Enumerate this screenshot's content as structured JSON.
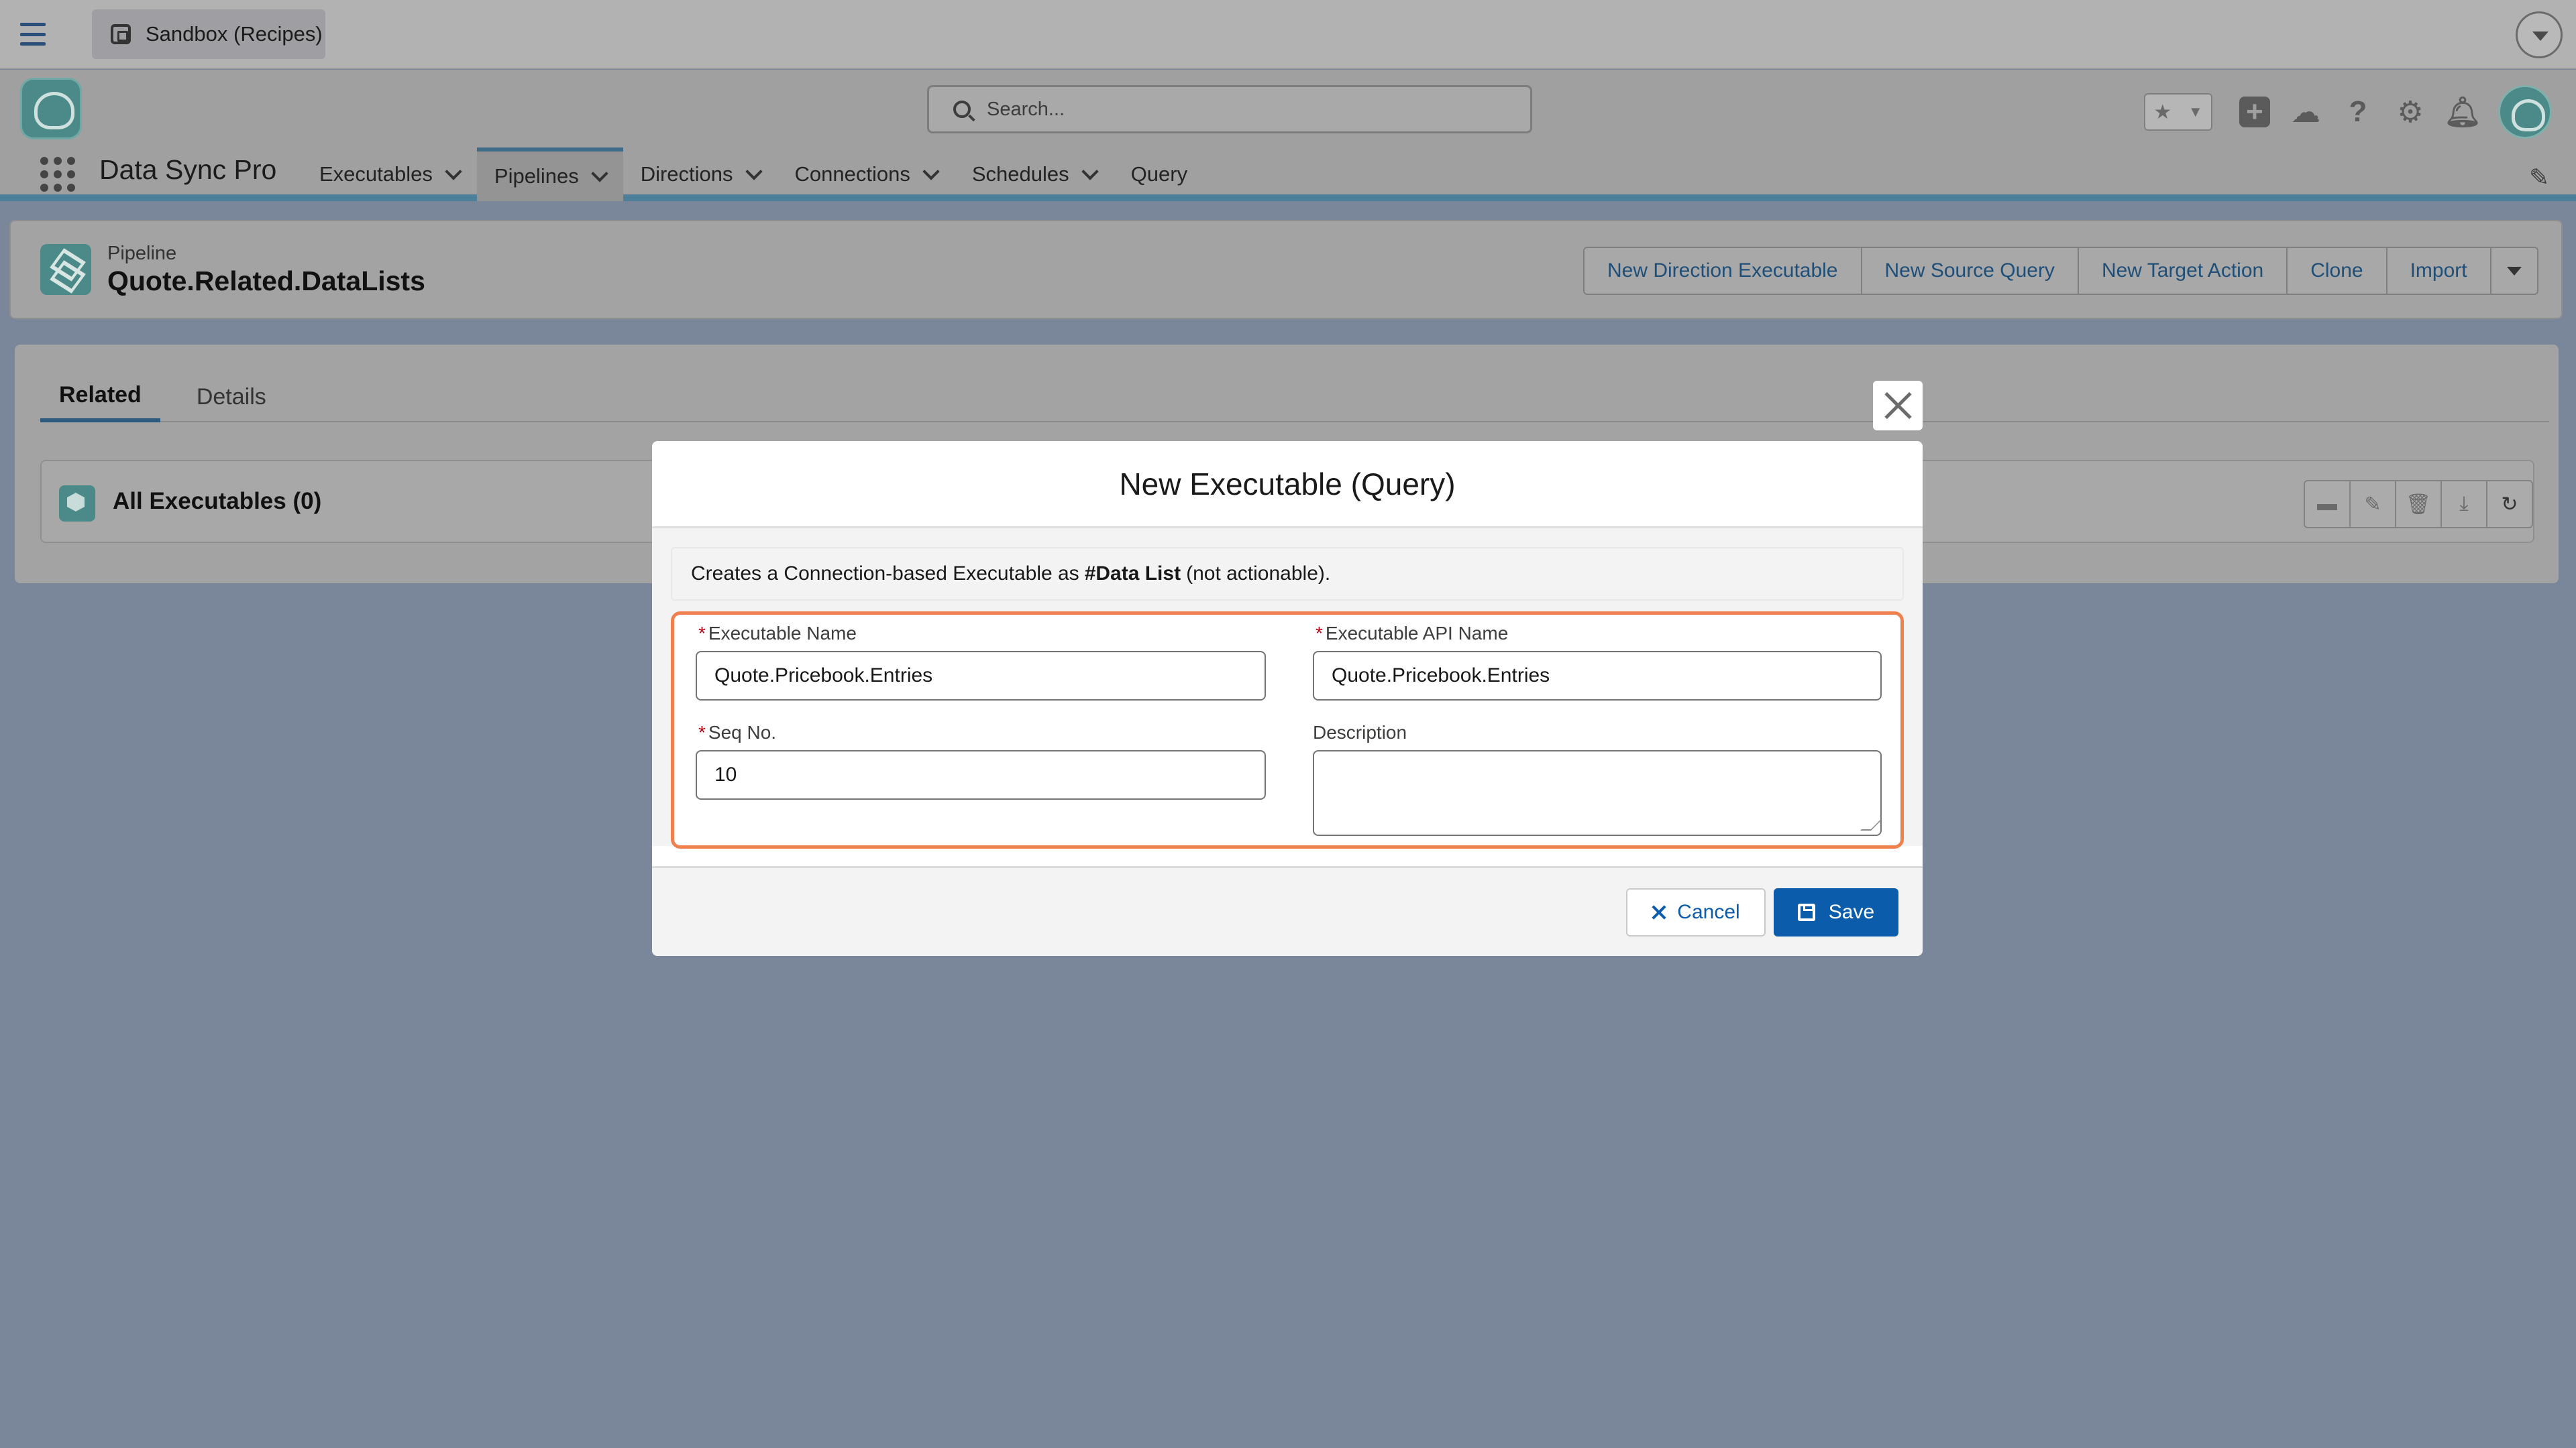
{
  "topbar": {
    "sandbox_label": "Sandbox (Recipes)"
  },
  "header": {
    "search_placeholder": "Search...",
    "app_name": "Data Sync Pro",
    "nav": [
      {
        "label": "Executables",
        "has_menu": true
      },
      {
        "label": "Pipelines",
        "has_menu": true,
        "active": true
      },
      {
        "label": "Directions",
        "has_menu": true
      },
      {
        "label": "Connections",
        "has_menu": true
      },
      {
        "label": "Schedules",
        "has_menu": true
      },
      {
        "label": "Query",
        "has_menu": false
      }
    ],
    "utility_icons": [
      "star-icon",
      "add-icon",
      "trailhead-icon",
      "help-icon",
      "setup-gear-icon",
      "bell-icon"
    ]
  },
  "record": {
    "object_type": "Pipeline",
    "title": "Quote.Related.DataLists",
    "actions": [
      "New Direction Executable",
      "New Source Query",
      "New Target Action",
      "Clone",
      "Import"
    ]
  },
  "tabs": [
    {
      "label": "Related",
      "active": true
    },
    {
      "label": "Details",
      "active": false
    }
  ],
  "related_list": {
    "title": "All Executables (0)",
    "action_icons": [
      "new-record-icon",
      "edit-icon",
      "delete-icon",
      "download-icon",
      "refresh-icon"
    ]
  },
  "modal": {
    "title": "New Executable (Query)",
    "info_prefix": "Creates a Connection-based Executable as",
    "info_bold": "#Data List",
    "info_suffix": "(not actionable).",
    "fields": {
      "executable_name": {
        "label": "Executable Name",
        "required": true,
        "value": "Quote.Pricebook.Entries"
      },
      "executable_api_name": {
        "label": "Executable API Name",
        "required": true,
        "value": "Quote.Pricebook.Entries"
      },
      "seq_no": {
        "label": "Seq No.",
        "required": true,
        "value": "10"
      },
      "description": {
        "label": "Description",
        "required": false,
        "value": ""
      }
    },
    "cancel_label": "Cancel",
    "save_label": "Save"
  },
  "colors": {
    "brand_blue": "#0b5cab",
    "highlight_orange": "#f0814e",
    "overlay_slate": "#7a8699",
    "app_teal": "#4b8a88"
  }
}
